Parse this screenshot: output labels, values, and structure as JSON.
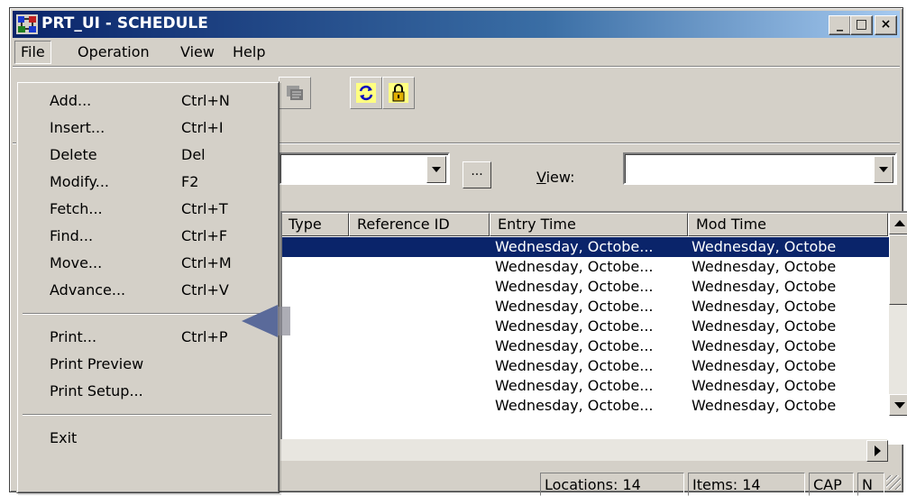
{
  "window": {
    "title": "PRT_UI - SCHEDULE",
    "controls": {
      "minimize": "_",
      "maximize": "□",
      "close": "×"
    }
  },
  "menubar": [
    "File",
    "Operation",
    "View",
    "Help"
  ],
  "file_menu": {
    "groups": [
      [
        {
          "label": "Add...",
          "shortcut": "Ctrl+N"
        },
        {
          "label": "Insert...",
          "shortcut": "Ctrl+I"
        },
        {
          "label": "Delete",
          "shortcut": "Del"
        },
        {
          "label": "Modify...",
          "shortcut": "F2"
        },
        {
          "label": "Fetch...",
          "shortcut": "Ctrl+T"
        },
        {
          "label": "Find...",
          "shortcut": "Ctrl+F"
        },
        {
          "label": "Move...",
          "shortcut": "Ctrl+M"
        },
        {
          "label": "Advance...",
          "shortcut": "Ctrl+V"
        }
      ],
      [
        {
          "label": "Print...",
          "shortcut": "Ctrl+P"
        },
        {
          "label": "Print Preview",
          "shortcut": ""
        },
        {
          "label": "Print Setup...",
          "shortcut": ""
        }
      ],
      [
        {
          "label": "Exit",
          "shortcut": ""
        }
      ]
    ]
  },
  "toolbar": {
    "icons": [
      "filter-icon",
      "refresh-icon",
      "lock-icon"
    ]
  },
  "filter": {
    "browse_label": "...",
    "view_label": "View:",
    "view_value": ""
  },
  "list": {
    "columns": [
      "Type",
      "Reference ID",
      "Entry Time",
      "Mod Time"
    ],
    "rows": [
      {
        "type": "",
        "ref": "",
        "entry": "",
        "mod": "",
        "selected": true
      },
      {
        "type": "",
        "ref": "",
        "entry": "Wednesday, Octobe...",
        "mod": "Wednesday, Octobe"
      },
      {
        "type": "",
        "ref": "",
        "entry": "Wednesday, Octobe...",
        "mod": "Wednesday, Octobe"
      },
      {
        "type": "",
        "ref": "",
        "entry": "Wednesday, Octobe...",
        "mod": "Wednesday, Octobe"
      },
      {
        "type": "",
        "ref": "",
        "entry": "Wednesday, Octobe...",
        "mod": "Wednesday, Octobe"
      },
      {
        "type": "",
        "ref": "",
        "entry": "Wednesday, Octobe...",
        "mod": "Wednesday, Octobe"
      },
      {
        "type": "",
        "ref": "",
        "entry": "Wednesday, Octobe...",
        "mod": "Wednesday, Octobe"
      },
      {
        "type": "",
        "ref": "",
        "entry": "Wednesday, Octobe...",
        "mod": "Wednesday, Octobe"
      },
      {
        "type": "",
        "ref": "",
        "entry": "Wednesday, Octobe...",
        "mod": "Wednesday, Octobe"
      }
    ],
    "selected_text": "Wednesday, Octobe... Wednesday, Octobe"
  },
  "status": {
    "locations": "Locations: 14",
    "items": "Items: 14",
    "cap": "CAP",
    "num": "N"
  },
  "colors": {
    "face": "#d4d0c8",
    "title_start": "#0a246a",
    "title_end": "#a6caf0",
    "selection": "#0a246a",
    "pointer": "#5a6a9a"
  }
}
